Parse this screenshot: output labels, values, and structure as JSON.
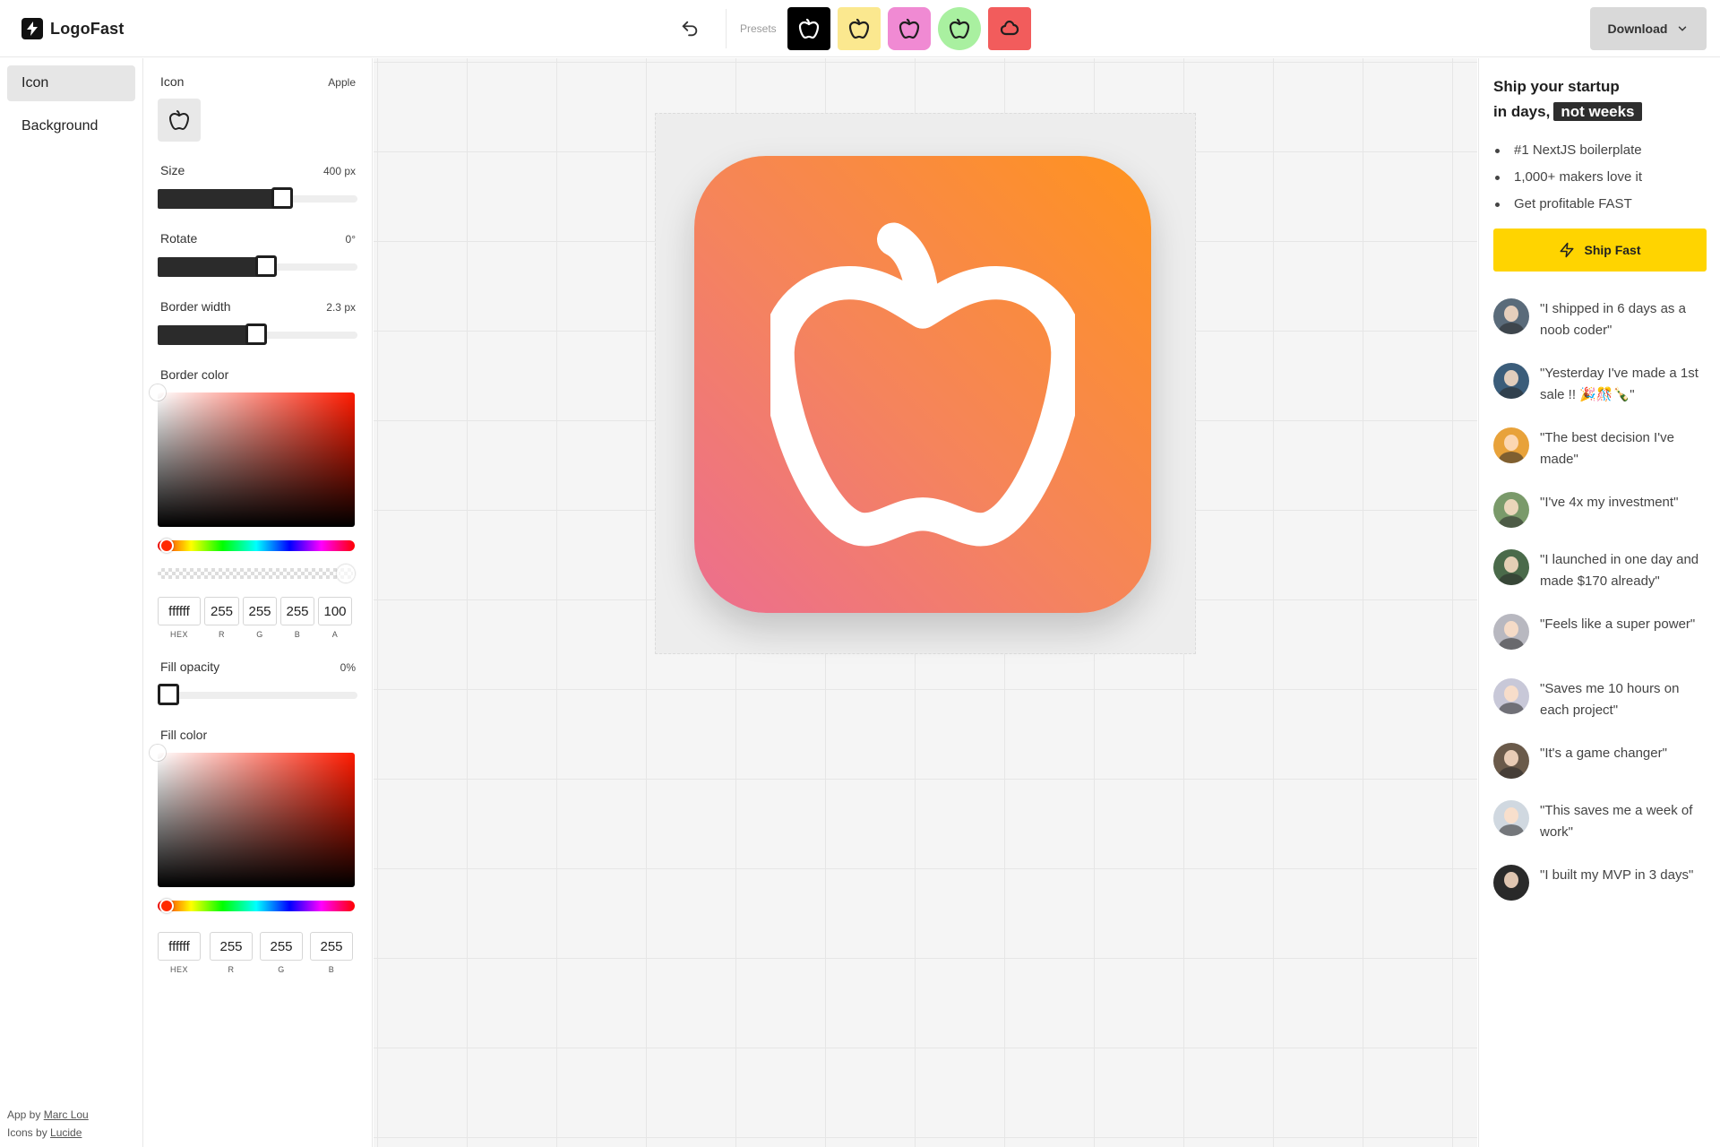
{
  "header": {
    "app_name": "LogoFast",
    "presets_label": "Presets",
    "download_label": "Download",
    "presets": [
      {
        "name": "preset-black",
        "bg": "#000000",
        "fg": "#ffffff",
        "shape": "apple"
      },
      {
        "name": "preset-yellow",
        "bg": "#fbe88f",
        "fg": "#1f1f1f",
        "shape": "apple"
      },
      {
        "name": "preset-pink",
        "bg": "#f08ad3",
        "fg": "#1f1f1f",
        "shape": "apple"
      },
      {
        "name": "preset-green",
        "bg": "#a9f0a0",
        "fg": "#1f1f1f",
        "shape": "apple"
      },
      {
        "name": "preset-red",
        "bg": "#f25c5c",
        "fg": "#1f1f1f",
        "shape": "cloud"
      }
    ]
  },
  "nav": {
    "items": [
      {
        "label": "Icon",
        "active": true
      },
      {
        "label": "Background",
        "active": false
      }
    ],
    "credits": {
      "app_by": "App by",
      "app_author": "Marc Lou",
      "icons_by": "Icons by",
      "icons_author": "Lucide"
    }
  },
  "settings": {
    "icon": {
      "label": "Icon",
      "value": "Apple"
    },
    "size": {
      "label": "Size",
      "value": "400 px",
      "fraction": 0.64
    },
    "rotate": {
      "label": "Rotate",
      "value": "0°",
      "fraction": 0.55
    },
    "border_width": {
      "label": "Border width",
      "value": "2.3 px",
      "fraction": 0.49
    },
    "border_color": {
      "label": "Border color",
      "hex": "ffffff",
      "r": "255",
      "g": "255",
      "b": "255",
      "a": "100",
      "captions": {
        "hex": "HEX",
        "r": "R",
        "g": "G",
        "b": "B",
        "a": "A"
      }
    },
    "fill_opacity": {
      "label": "Fill opacity",
      "value": "0%",
      "fraction": 0
    },
    "fill_color": {
      "label": "Fill color",
      "hex": "ffffff",
      "r": "255",
      "g": "255",
      "b": "255",
      "captions": {
        "hex": "HEX",
        "r": "R",
        "g": "G",
        "b": "B"
      }
    }
  },
  "canvas": {
    "gradient_start": "#ec6e8f",
    "gradient_end": "#ff931e",
    "icon_color": "#ffffff",
    "icon": "apple-icon"
  },
  "promo": {
    "title_line1": "Ship your startup",
    "title_line2": "in days,",
    "title_highlight": "not weeks",
    "bullets": [
      "#1 NextJS boilerplate",
      "1,000+ makers love it",
      "Get profitable FAST"
    ],
    "cta": "Ship Fast",
    "cta_color": "#ffd400",
    "testimonials": [
      {
        "quote": "\"I shipped in 6 days as a noob coder\"",
        "avatar_color": "#5a6b7a"
      },
      {
        "quote": "\"Yesterday I've made a 1st sale !! 🎉🎊🍾\"",
        "avatar_color": "#3b5d7a"
      },
      {
        "quote": "\"The best decision I've made\"",
        "avatar_color": "#e8a23a"
      },
      {
        "quote": "\"I've 4x my investment\"",
        "avatar_color": "#7a9a6a"
      },
      {
        "quote": "\"I launched in one day and made $170 already\"",
        "avatar_color": "#4a6a4a"
      },
      {
        "quote": "\"Feels like a super power\"",
        "avatar_color": "#b8b8c0"
      },
      {
        "quote": "\"Saves me 10 hours on each project\"",
        "avatar_color": "#c8c8d8"
      },
      {
        "quote": "\"It's a game changer\"",
        "avatar_color": "#6a5a4a"
      },
      {
        "quote": "\"This saves me a week of work\"",
        "avatar_color": "#d0d8e0"
      },
      {
        "quote": "\"I built my MVP in 3 days\"",
        "avatar_color": "#2a2a2a"
      }
    ]
  }
}
